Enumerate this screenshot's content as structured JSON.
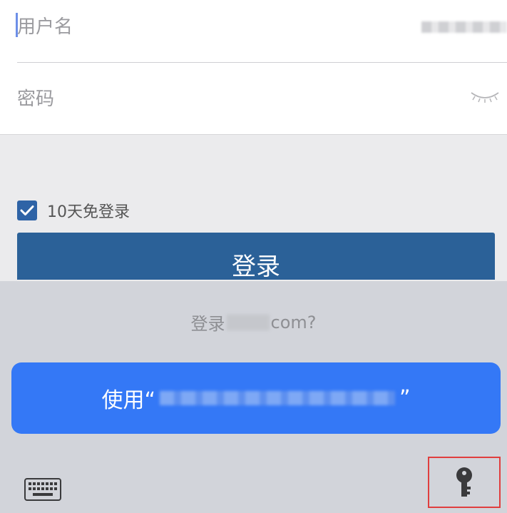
{
  "form": {
    "username_placeholder": "用户名",
    "password_placeholder": "密码"
  },
  "remember": {
    "label": "10天免登录",
    "checked": true
  },
  "login_button": {
    "label": "登录"
  },
  "autofill": {
    "prompt_prefix": "登录",
    "prompt_suffix": "com?",
    "use_prefix": "使用“",
    "use_suffix": "”"
  },
  "icons": {
    "eye": "eye-closed-icon",
    "check": "checkmark-icon",
    "keyboard": "keyboard-icon",
    "key": "key-icon"
  },
  "colors": {
    "login_button": "#2b6198",
    "use_button": "#3478f6",
    "highlight_box": "#e03e3e"
  }
}
